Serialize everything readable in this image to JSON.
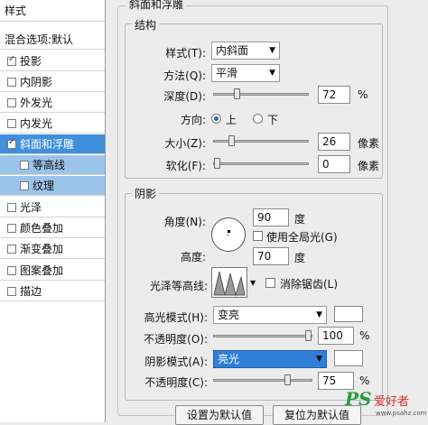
{
  "left_panel": {
    "header": "样式",
    "blend_options": "混合选项:默认",
    "items": [
      {
        "label": "投影",
        "checked": true
      },
      {
        "label": "内阴影",
        "checked": false
      },
      {
        "label": "外发光",
        "checked": false
      },
      {
        "label": "内发光",
        "checked": false
      },
      {
        "label": "斜面和浮雕",
        "checked": true,
        "selected": true
      },
      {
        "label": "等高线",
        "checked": false,
        "sub": true
      },
      {
        "label": "纹理",
        "checked": false,
        "sub": true
      },
      {
        "label": "光泽",
        "checked": false
      },
      {
        "label": "颜色叠加",
        "checked": false
      },
      {
        "label": "渐变叠加",
        "checked": false
      },
      {
        "label": "图案叠加",
        "checked": false
      },
      {
        "label": "描边",
        "checked": false
      }
    ]
  },
  "bevel": {
    "section_title": "斜面和浮雕",
    "structure_title": "结构",
    "style_label": "样式(T):",
    "style_value": "内斜面",
    "technique_label": "方法(Q):",
    "technique_value": "平滑",
    "depth_label": "深度(D):",
    "depth_value": "72",
    "depth_unit": "%",
    "direction_label": "方向:",
    "direction_up": "上",
    "direction_down": "下",
    "size_label": "大小(Z):",
    "size_value": "26",
    "size_unit": "像素",
    "soften_label": "软化(F):",
    "soften_value": "0",
    "soften_unit": "像素"
  },
  "shading": {
    "title": "阴影",
    "angle_label": "角度(N):",
    "angle_value": "90",
    "angle_unit": "度",
    "global_light_label": "使用全局光(G)",
    "altitude_label": "高度:",
    "altitude_value": "70",
    "altitude_unit": "度",
    "gloss_contour_label": "光泽等高线:",
    "antialiased_label": "消除锯齿(L)",
    "highlight_mode_label": "高光模式(H):",
    "highlight_mode_value": "变亮",
    "highlight_opacity_label": "不透明度(O):",
    "highlight_opacity_value": "100",
    "highlight_opacity_unit": "%",
    "shadow_mode_label": "阴影模式(A):",
    "shadow_mode_value": "亮光",
    "shadow_opacity_label": "不透明度(C):",
    "shadow_opacity_value": "75",
    "shadow_opacity_unit": "%"
  },
  "buttons": {
    "make_default": "设置为默认值",
    "reset_default": "复位为默认值"
  },
  "watermark": {
    "text": "PS 爱好者",
    "url": "www.psahz.com"
  }
}
